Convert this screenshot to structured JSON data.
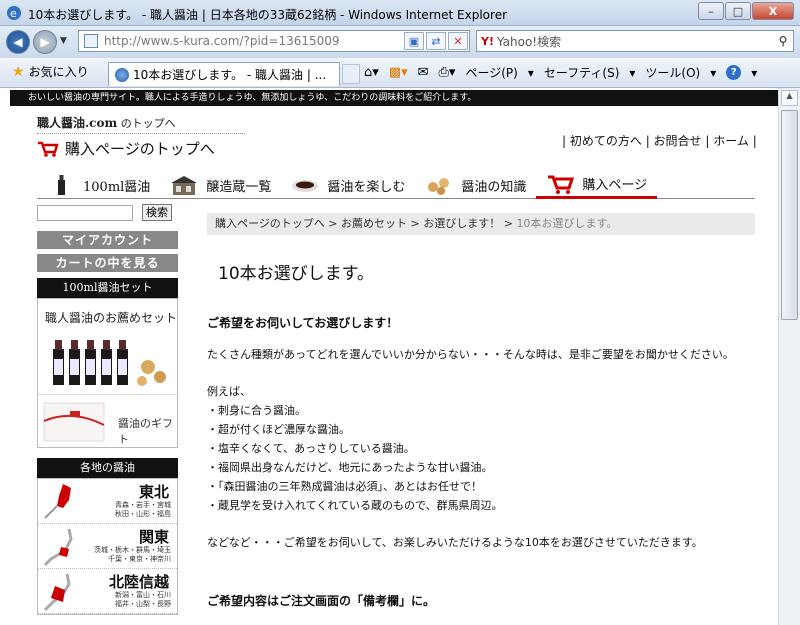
{
  "window": {
    "title": "10本お選びします。 - 職人醤油 | 日本各地の33蔵62銘柄 - Windows Internet Explorer",
    "buttons": [
      "–",
      "□",
      "X"
    ]
  },
  "address": {
    "url": "http://www.s-kura.com/?pid=13615009",
    "search_label": "Yahoo!検索",
    "search_logo": "Y!"
  },
  "favorites": {
    "label": "お気に入り",
    "tab_title": "10本お選びします。 - 職人醤油 | ..."
  },
  "commands": {
    "page": "ページ(P)",
    "safety": "セーフティ(S)",
    "tools": "ツール(O)",
    "help": "?"
  },
  "site": {
    "top_strip": "おいしい醤油の専門サイト。職人による手造りしょうゆ、無添加しょうゆ、こだわりの調味料をご紹介します。",
    "logo_main": "職人醤油.com",
    "logo_sub": "のトップへ",
    "buy_top": "購入ページのトップへ",
    "links": [
      "初めての方へ",
      "お問合せ",
      "ホーム"
    ],
    "nav": [
      {
        "label": "100ml醤油"
      },
      {
        "label": "醸造蔵一覧"
      },
      {
        "label": "醤油を楽しむ"
      },
      {
        "label": "醤油の知識"
      },
      {
        "label": "購入ページ"
      }
    ]
  },
  "sidebar": {
    "search_button": "検索",
    "my_account": "マイアカウント",
    "cart": "カートの中を見る",
    "set_header": "100ml醤油セット",
    "reco_label": "職人醤油のお薦めセット",
    "gift_label": "醤油のギフト",
    "region_header": "各地の醤油",
    "regions": [
      {
        "name": "東北",
        "sub1": "青森・岩手・宮城",
        "sub2": "秋田・山形・福島"
      },
      {
        "name": "関東",
        "sub1": "茨城・栃木・群馬・埼玉",
        "sub2": "千葉・東京・神奈川"
      },
      {
        "name": "北陸信越",
        "sub1": "新潟・富山・石川",
        "sub2": "福井・山梨・長野"
      }
    ]
  },
  "main": {
    "breadcrumb": {
      "c1": "購入ページのトップへ",
      "c2": "お薦めセット",
      "c3": "お選びします！",
      "current": "10本お選びします。"
    },
    "heading": "10本お選びします。",
    "lead": "ご希望をお伺いしてお選びします！",
    "intro": "たくさん種類があってどれを選んでいいか分からない・・・そんな時は、是非ご要望をお聞かせください。",
    "examples_title": "例えば、",
    "examples": [
      "・刺身に合う醤油。",
      "・超が付くほど濃厚な醤油。",
      "・塩辛くなくて、あっさりしている醤油。",
      "・福岡県出身なんだけど、地元にあったような甘い醤油。",
      "・「森田醤油の三年熟成醤油は必須」、あとはお任せで！",
      "・蔵見学を受け入れてくれている蔵のもので、群馬県周辺。"
    ],
    "closing": "などなど・・・ご希望をお伺いして、お楽しみいただけるような10本をお選びさせていただきます。",
    "note": "ご希望内容はご注文画面の「備考欄」に。"
  }
}
